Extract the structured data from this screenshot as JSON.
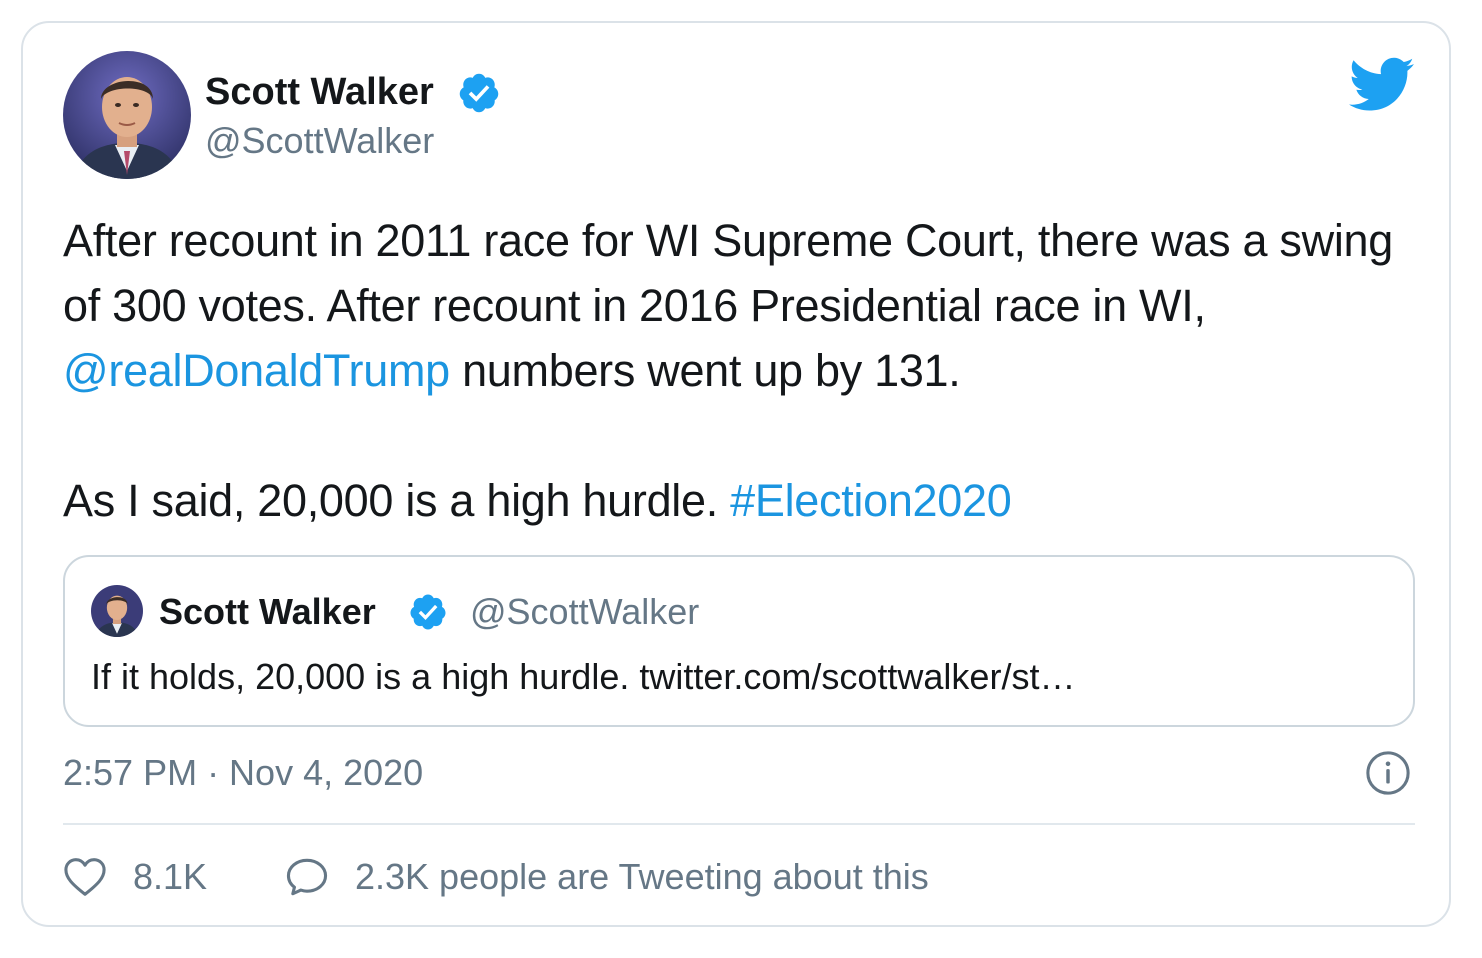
{
  "tweet": {
    "author_name": "Scott Walker",
    "author_handle": "@ScottWalker",
    "paragraph1_part1": "After recount in 2011 race for WI Supreme Court, there was a swing of 300 votes. After recount in 2016 Presidential race in WI, ",
    "mention": "@realDonaldTrump",
    "paragraph1_part2": " numbers went up by 131.",
    "paragraph2_part1": "As I said, 20,000 is a high hurdle. ",
    "hashtag": "#Election2020",
    "timestamp": "2:57 PM · Nov 4, 2020",
    "likes": "8.1K",
    "conversation": "2.3K people are Tweeting about this"
  },
  "quoted": {
    "author_name": "Scott Walker",
    "author_handle": "@ScottWalker",
    "text": "If it holds, 20,000 is a high hurdle. twitter.com/scottwalker/st…"
  },
  "icons": {
    "brand": "twitter-bird-icon",
    "verified": "verified-badge-icon",
    "info": "info-icon",
    "like": "heart-icon",
    "reply": "speech-bubble-icon"
  },
  "colors": {
    "link": "#1b95e0",
    "brand": "#1da1f2",
    "text": "#14171a",
    "secondary": "#657786",
    "border": "#dbe2e8"
  }
}
